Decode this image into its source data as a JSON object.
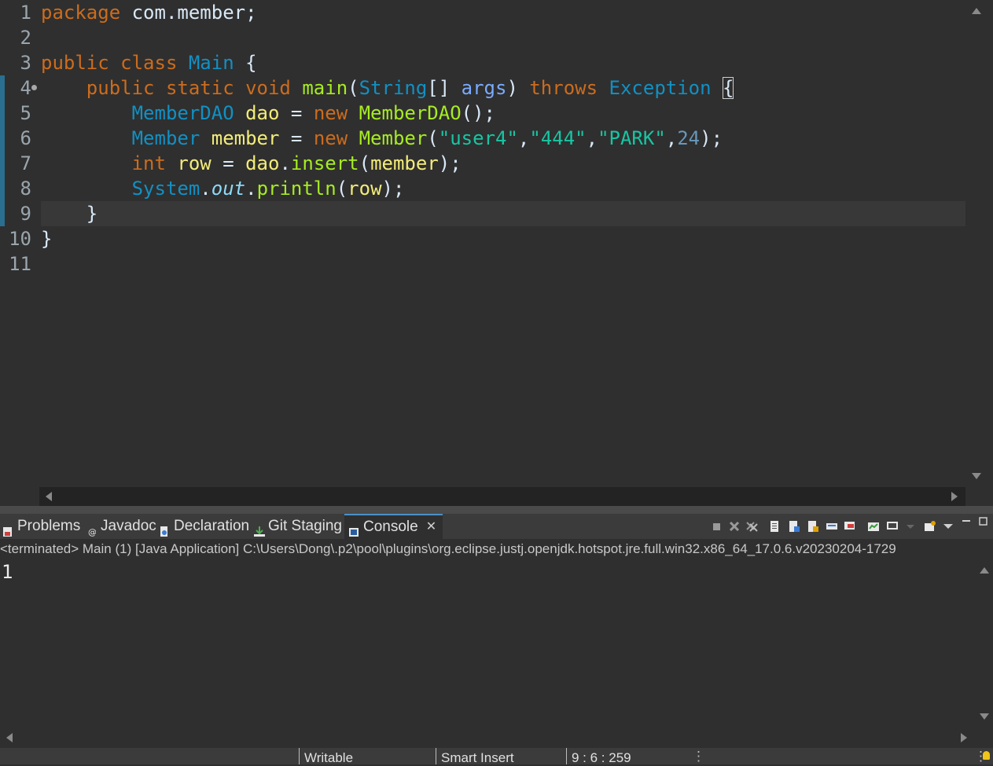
{
  "editor": {
    "line_numbers": [
      "1",
      "2",
      "3",
      "4",
      "5",
      "6",
      "7",
      "8",
      "9",
      "10",
      "11"
    ],
    "lines": [
      [
        {
          "t": "package",
          "c": "kw"
        },
        {
          "t": " com.member;",
          "c": "pl"
        }
      ],
      [],
      [
        {
          "t": "public class ",
          "c": "kw"
        },
        {
          "t": "Main",
          "c": "cls"
        },
        {
          "t": " {",
          "c": "pl"
        }
      ],
      [
        {
          "t": "    ",
          "c": "pl"
        },
        {
          "t": "public static void ",
          "c": "kw"
        },
        {
          "t": "main",
          "c": "mth"
        },
        {
          "t": "(",
          "c": "pl"
        },
        {
          "t": "String",
          "c": "cls"
        },
        {
          "t": "[] ",
          "c": "pl"
        },
        {
          "t": "args",
          "c": "prm"
        },
        {
          "t": ") ",
          "c": "pl"
        },
        {
          "t": "throws ",
          "c": "kw"
        },
        {
          "t": "Exception",
          "c": "cls"
        },
        {
          "t": " ",
          "c": "pl"
        },
        {
          "t": "{",
          "c": "brace"
        }
      ],
      [
        {
          "t": "        ",
          "c": "pl"
        },
        {
          "t": "MemberDAO",
          "c": "cls"
        },
        {
          "t": " ",
          "c": "pl"
        },
        {
          "t": "dao",
          "c": "var"
        },
        {
          "t": " = ",
          "c": "pl"
        },
        {
          "t": "new ",
          "c": "kw"
        },
        {
          "t": "MemberDAO",
          "c": "mth"
        },
        {
          "t": "();",
          "c": "pl"
        }
      ],
      [
        {
          "t": "        ",
          "c": "pl"
        },
        {
          "t": "Member",
          "c": "cls"
        },
        {
          "t": " ",
          "c": "pl"
        },
        {
          "t": "member",
          "c": "var"
        },
        {
          "t": " = ",
          "c": "pl"
        },
        {
          "t": "new ",
          "c": "kw"
        },
        {
          "t": "Member",
          "c": "mth"
        },
        {
          "t": "(",
          "c": "pl"
        },
        {
          "t": "\"user4\"",
          "c": "str"
        },
        {
          "t": ",",
          "c": "pl"
        },
        {
          "t": "\"444\"",
          "c": "str"
        },
        {
          "t": ",",
          "c": "pl"
        },
        {
          "t": "\"PARK\"",
          "c": "str"
        },
        {
          "t": ",",
          "c": "pl"
        },
        {
          "t": "24",
          "c": "num"
        },
        {
          "t": ");",
          "c": "pl"
        }
      ],
      [
        {
          "t": "        ",
          "c": "pl"
        },
        {
          "t": "int ",
          "c": "kw"
        },
        {
          "t": "row",
          "c": "var"
        },
        {
          "t": " = ",
          "c": "pl"
        },
        {
          "t": "dao",
          "c": "var"
        },
        {
          "t": ".",
          "c": "pl"
        },
        {
          "t": "insert",
          "c": "mth"
        },
        {
          "t": "(",
          "c": "pl"
        },
        {
          "t": "member",
          "c": "var"
        },
        {
          "t": ");",
          "c": "pl"
        }
      ],
      [
        {
          "t": "        ",
          "c": "pl"
        },
        {
          "t": "System",
          "c": "cls"
        },
        {
          "t": ".",
          "c": "pl"
        },
        {
          "t": "out",
          "c": "fld"
        },
        {
          "t": ".",
          "c": "pl"
        },
        {
          "t": "println",
          "c": "mth"
        },
        {
          "t": "(",
          "c": "pl"
        },
        {
          "t": "row",
          "c": "var"
        },
        {
          "t": ");",
          "c": "pl"
        }
      ],
      [
        {
          "t": "    }",
          "c": "pl"
        }
      ],
      [
        {
          "t": "}",
          "c": "pl"
        }
      ],
      []
    ],
    "colors": {
      "keyword": "#cc6c1d",
      "class": "#1290c3",
      "method": "#a7ec21",
      "string": "#17c6a3",
      "number": "#6897bb",
      "variable": "#f3ec79",
      "parameter": "#79abff",
      "field": "#8ddaf8",
      "plain": "#d9e8f7"
    }
  },
  "panel": {
    "tabs": [
      {
        "label": "Problems",
        "icon": "problems-icon"
      },
      {
        "label": "Javadoc",
        "icon": "javadoc-icon"
      },
      {
        "label": "Declaration",
        "icon": "declaration-icon"
      },
      {
        "label": "Git Staging",
        "icon": "git-staging-icon"
      },
      {
        "label": "Console",
        "icon": "console-icon",
        "active": true,
        "close": "✕"
      }
    ],
    "process_info": "<terminated> Main (1) [Java Application] C:\\Users\\Dong\\.p2\\pool\\plugins\\org.eclipse.justj.openjdk.hotspot.jre.full.win32.x86_64_17.0.6.v20230204-1729",
    "console_output": "1",
    "toolbar_icons": [
      "terminate-icon",
      "remove-launch-icon",
      "remove-all-terminated-icon",
      "scroll-lock-icon",
      "word-wrap-icon",
      "show-stdout-icon",
      "show-stderr-icon",
      "pin-console-icon",
      "display-console-icon",
      "open-console-icon",
      "view-menu-icon",
      "minimize-icon",
      "maximize-icon"
    ]
  },
  "statusbar": {
    "writable": "Writable",
    "insert_mode": "Smart Insert",
    "position": "9 : 6 : 259"
  }
}
